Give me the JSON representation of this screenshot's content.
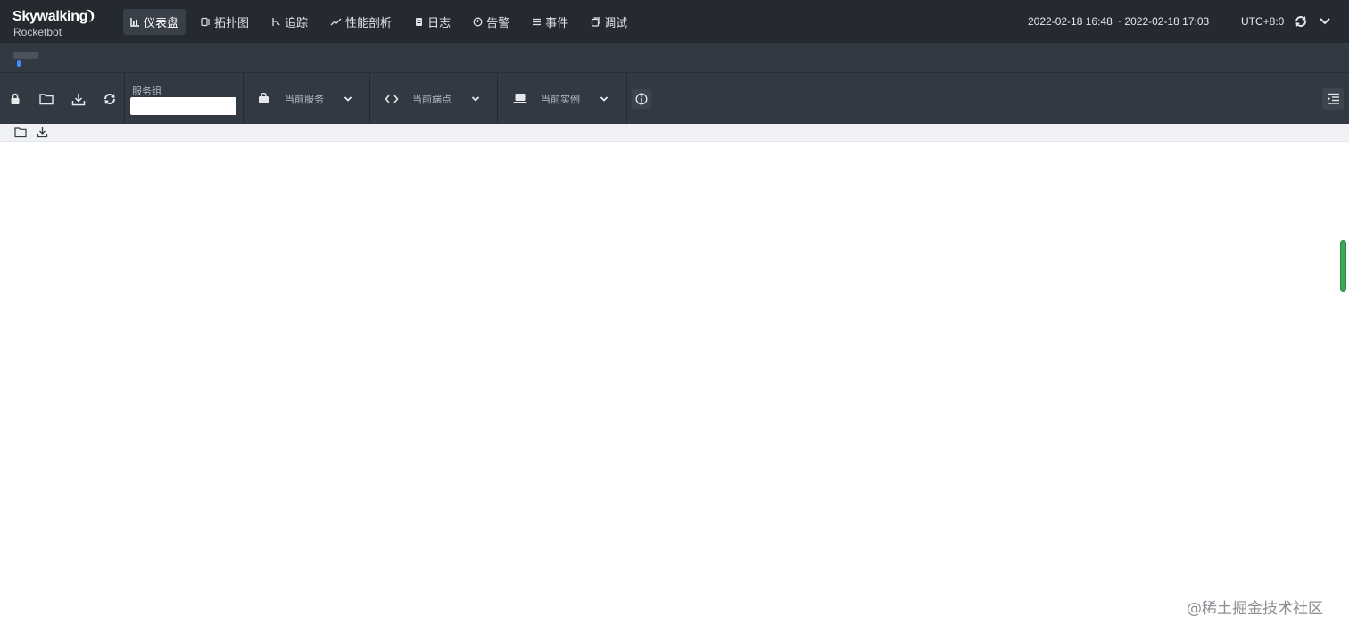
{
  "brand": {
    "name": "Skywalking",
    "subtitle": "Rocketbot"
  },
  "nav": [
    {
      "label": "仪表盘",
      "icon": "dashboard-icon",
      "active": true
    },
    {
      "label": "拓扑图",
      "icon": "topology-icon"
    },
    {
      "label": "追踪",
      "icon": "trace-icon"
    },
    {
      "label": "性能剖析",
      "icon": "profile-icon"
    },
    {
      "label": "日志",
      "icon": "log-icon"
    },
    {
      "label": "告警",
      "icon": "alarm-icon"
    },
    {
      "label": "事件",
      "icon": "event-icon"
    },
    {
      "label": "调试",
      "icon": "debug-icon"
    }
  ],
  "header": {
    "time_range": "2022-02-18 16:48 ~ 2022-02-18 17:03",
    "timezone": "UTC+8:0"
  },
  "toolbar": {
    "service_group_label": "服务组",
    "service_group_value": "",
    "current_service": "当前服务",
    "current_endpoint": "当前端点",
    "current_instance": "当前实例"
  },
  "watermark": "@稀土掘金技术社区",
  "colors": {
    "topbar_bg": "#252a31",
    "toolbar_bg": "#333943",
    "accent": "#448dfe",
    "scrollbar": "#3aa856"
  }
}
